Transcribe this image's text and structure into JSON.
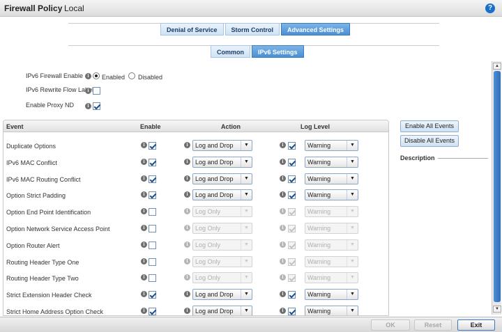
{
  "header": {
    "title": "Firewall Policy",
    "context": "Local",
    "help_label": "?"
  },
  "top_tabs": [
    "Denial of Service",
    "Storm Control",
    "Advanced Settings"
  ],
  "sub_tabs": [
    "Common",
    "IPv6 Settings"
  ],
  "options": {
    "firewall_label": "IPv6 Firewall Enable",
    "enabled_label": "Enabled",
    "disabled_label": "Disabled",
    "rewrite_label": "IPv6 Rewrite Flow Label",
    "proxy_label": "Enable Proxy ND"
  },
  "table": {
    "headers": {
      "event": "Event",
      "enable": "Enable",
      "action": "Action",
      "log_level": "Log Level"
    },
    "rows": [
      {
        "name": "Duplicate Options",
        "enabled": true,
        "action": "Log and Drop",
        "log_checked": true,
        "log_level": "Warning"
      },
      {
        "name": "IPv6 MAC Conflict",
        "enabled": true,
        "action": "Log and Drop",
        "log_checked": true,
        "log_level": "Warning"
      },
      {
        "name": "IPv6 MAC Routing Conflict",
        "enabled": true,
        "action": "Log and Drop",
        "log_checked": true,
        "log_level": "Warning"
      },
      {
        "name": "Option Strict Padding",
        "enabled": true,
        "action": "Log and Drop",
        "log_checked": true,
        "log_level": "Warning"
      },
      {
        "name": "Option End Point Identification",
        "enabled": false,
        "action": "Log Only",
        "log_checked": true,
        "log_level": "Warning"
      },
      {
        "name": "Option Network Service Access Point",
        "enabled": false,
        "action": "Log Only",
        "log_checked": true,
        "log_level": "Warning"
      },
      {
        "name": "Option Router Alert",
        "enabled": false,
        "action": "Log Only",
        "log_checked": true,
        "log_level": "Warning"
      },
      {
        "name": "Routing Header Type One",
        "enabled": false,
        "action": "Log Only",
        "log_checked": true,
        "log_level": "Warning"
      },
      {
        "name": "Routing Header Type Two",
        "enabled": false,
        "action": "Log Only",
        "log_checked": true,
        "log_level": "Warning"
      },
      {
        "name": "Strict Extension Header Check",
        "enabled": true,
        "action": "Log and Drop",
        "log_checked": true,
        "log_level": "Warning"
      },
      {
        "name": "Strict Home Address Option Check",
        "enabled": true,
        "action": "Log and Drop",
        "log_checked": true,
        "log_level": "Warning"
      }
    ]
  },
  "side": {
    "enable_all": "Enable All Events",
    "disable_all": "Disable All Events",
    "description": "Description"
  },
  "footer": {
    "ok": "OK",
    "reset": "Reset",
    "exit": "Exit"
  }
}
